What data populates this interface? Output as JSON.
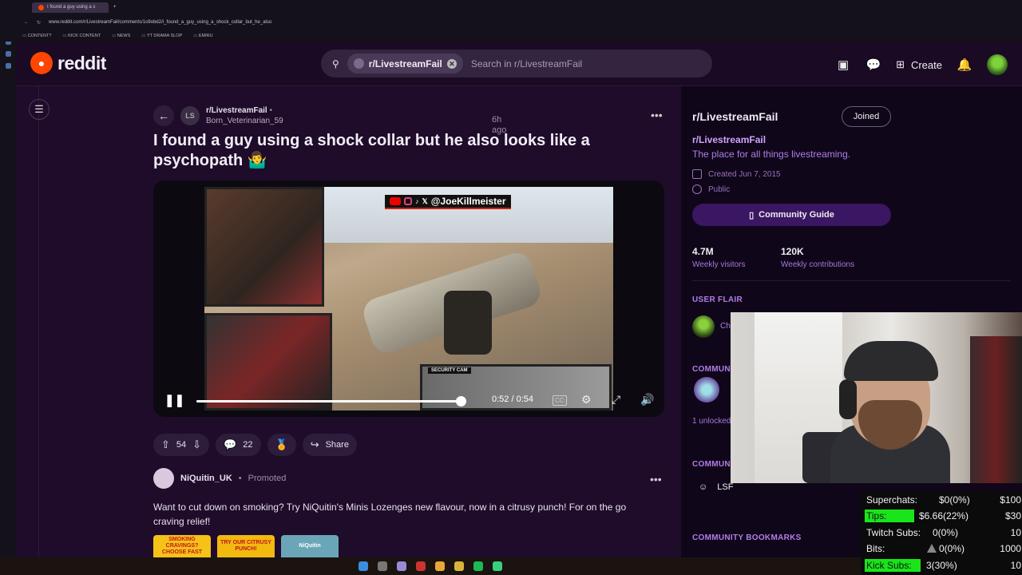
{
  "browser": {
    "tab_title": "I found a guy using a s",
    "url": "www.reddit.com/r/LivestreamFail/comments/1o9obd2/i_found_a_guy_using_a_shock_collar_but_he_also",
    "bookmarks": [
      "CONTENT?",
      "KICK CONTENT",
      "NEWS",
      "YT DRAMA SLOP",
      "EMIRU"
    ]
  },
  "header": {
    "logo_text": "reddit",
    "search_chip": "r/LivestreamFail",
    "search_placeholder": "Search in r/LivestreamFail",
    "create_label": "Create"
  },
  "post": {
    "subreddit": "r/LivestreamFail",
    "subreddit_icon_text": "LS",
    "time": "6h ago",
    "author": "Born_Veterinarian_59",
    "title": "I found a guy using a shock collar but he also looks like a psychopath 🤷‍♂️",
    "video": {
      "banner_handle": "@JoeKillmeister",
      "security_cam_label": "SECURITY CAM",
      "time": "0:52 / 0:54",
      "progress": 0.963
    },
    "votes": "54",
    "comments": "22",
    "share_label": "Share"
  },
  "promo": {
    "name": "NiQuitin_UK",
    "tag": "Promoted",
    "body": "Want to cut down on smoking? Try NiQuitin's Minis Lozenges new flavour, now in a citrusy punch! For on the go craving relief!",
    "thumbs": [
      "SMOKING CRAVINGS? CHOOSE FAST",
      "TRY OUR CITRUSY PUNCH!",
      "NiQuitin"
    ]
  },
  "sidebar": {
    "title": "r/LivestreamFail",
    "joined_label": "Joined",
    "sub_name": "r/LivestreamFail",
    "description": "The place for all things livestreaming.",
    "created": "Created Jun 7, 2015",
    "visibility": "Public",
    "guide_label": "Community Guide",
    "visitors_value": "4.7M",
    "visitors_label": "Weekly visitors",
    "contrib_value": "120K",
    "contrib_label": "Weekly contributions",
    "user_flair_heading": "USER FLAIR",
    "flair_text": "Ch",
    "community_heading_1": "COMMUN",
    "unlocked_text": "1 unlocked",
    "community_heading_2": "COMMUN",
    "lsf_label": "LSF",
    "bookmarks_heading": "COMMUNITY BOOKMARKS"
  },
  "stream_stats": {
    "superchats_label": "Superchats:",
    "superchats_value": "$0(0%)",
    "superchats_goal": "$100",
    "tips_label": "Tips:",
    "tips_value": "$6.66(22%)",
    "tips_goal": "$30",
    "twitch_label": "Twitch Subs:",
    "twitch_value": "0(0%)",
    "twitch_goal": "10",
    "bits_label": "Bits:",
    "bits_value": "0(0%)",
    "bits_goal": "1000",
    "kick_label": "Kick Subs:",
    "kick_value": "3(30%)",
    "kick_goal": "10"
  },
  "colors": {
    "reddit_orange": "#ff4500",
    "highlight_green": "#19e51a",
    "page_bg": "#1e0c2a"
  }
}
